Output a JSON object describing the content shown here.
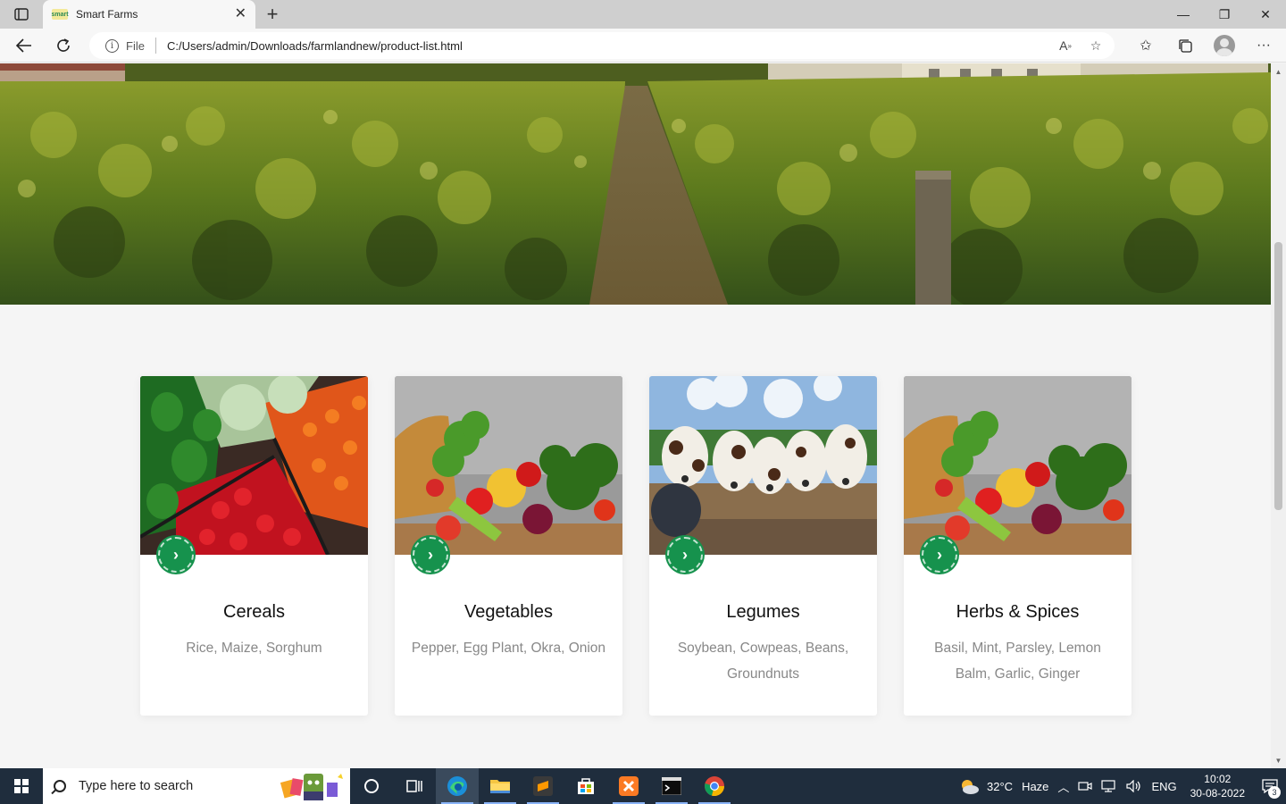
{
  "browser": {
    "tab_title": "Smart Farms",
    "favicon_text": "smart",
    "address_prefix": "File",
    "url": "C:/Users/admin/Downloads/farmlandnew/product-list.html"
  },
  "hero": {
    "image": "vineyard rows"
  },
  "cards": [
    {
      "title": "Cereals",
      "description": "Rice, Maize, Sorghum",
      "image": "crates of peppers, cabbage and habaneros"
    },
    {
      "title": "Vegetables",
      "description": "Pepper, Egg Plant, Okra, Onion",
      "image": "basket of fresh vegetables"
    },
    {
      "title": "Legumes",
      "description": "Soybean, Cowpeas, Beans, Groundnuts",
      "image": "group of cows in a field"
    },
    {
      "title": "Herbs & Spices",
      "description": "Basil, Mint, Parsley, Lemon Balm, Garlic, Ginger",
      "image": "basket of fresh vegetables"
    }
  ],
  "taskbar": {
    "search_placeholder": "Type here to search",
    "weather_temp": "32°C",
    "weather_desc": "Haze",
    "language": "ENG",
    "time": "10:02",
    "date": "30-08-2022",
    "notification_count": "3"
  },
  "colors": {
    "accent": "#16924d",
    "taskbar": "#1f2d3d"
  }
}
